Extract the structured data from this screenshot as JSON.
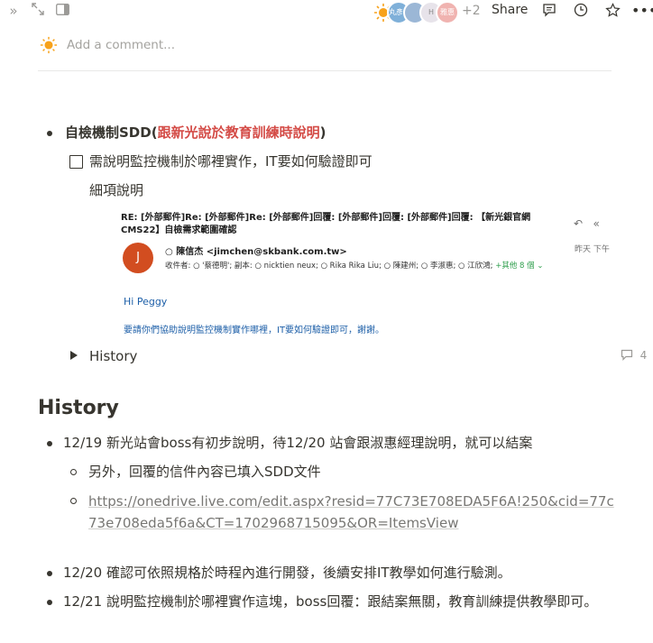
{
  "topbar": {
    "left_icons": [
      "double-chevron-right-icon",
      "expand-icon",
      "sidebar-panel-icon"
    ],
    "avatars": [
      {
        "name": "sun-avatar",
        "color": "#f7a21b",
        "label": ""
      },
      {
        "name": "user-avatar-1",
        "color": "#7fb0d9",
        "label": "丸彥 雲晴"
      },
      {
        "name": "user-avatar-2",
        "color": "#9bb7d6",
        "label": ""
      },
      {
        "name": "user-avatar-3",
        "color": "#e7e3ea",
        "label": "H"
      },
      {
        "name": "user-avatar-4",
        "color": "#f0b3b0",
        "label": "雅惠"
      }
    ],
    "avatar_more": "+2",
    "share_label": "Share",
    "right_icons": [
      "comment-icon",
      "clock-icon",
      "star-icon",
      "more-icon"
    ]
  },
  "comment": {
    "placeholder": "Add a comment..."
  },
  "content": {
    "item1_prefix": "自檢機制SDD(",
    "item1_red": "跟新光說於教育訓練時說明",
    "item1_suffix": ")",
    "todo_text": "需說明監控機制於哪裡實作，IT要如何驗證即可",
    "detail_label": "細項說明",
    "email": {
      "subject": "RE: [外部郵件]Re: [外部郵件]Re: [外部郵件]回覆: [外部郵件]回覆: [外部郵件]回覆: 【新光銀官網 CMS22】自檢需求範圍確認",
      "avatar_letter": "J",
      "from": "陳信杰 <jimchen@skbank.com.tw>",
      "time": "昨天 下午",
      "to_line": "收件者:  ○ '蔡德明';  副本:  ○ nicktien neux;  ○ Rika Rika Liu;  ○ 陳建州;  ○ 李淑惠;  ○ 江欣鴻;",
      "more": "+其他 8 個",
      "greeting": "Hi Peggy",
      "body": "要請你們協助說明監控機制實作哪裡，IT要如何驗證即可，謝謝。"
    },
    "toggle_label": "History",
    "comment_count": "4"
  },
  "history": {
    "heading": "History",
    "items": [
      {
        "text": "12/19 新光站會boss有初步說明，待12/20 站會跟淑惠經理說明，就可以結案"
      },
      {
        "text": "另外，回覆的信件內容已填入SDD文件"
      },
      {
        "text": "https://onedrive.live.com/edit.aspx?resid=77C73E708EDA5F6A!250&cid=77c73e708eda5f6a&CT=1702968715095&OR=ItemsView"
      },
      {
        "text": "12/20 確認可依照規格於時程內進行開發，後續安排IT教學如何進行驗測。"
      },
      {
        "text": "12/21 說明監控機制於哪裡實作這塊，boss回覆：跟結案無關，教育訓練提供教學即可。"
      }
    ]
  },
  "colors": {
    "accent_red": "#d44c47",
    "link_gray": "#787774",
    "email_blue": "#1d5fa8"
  }
}
